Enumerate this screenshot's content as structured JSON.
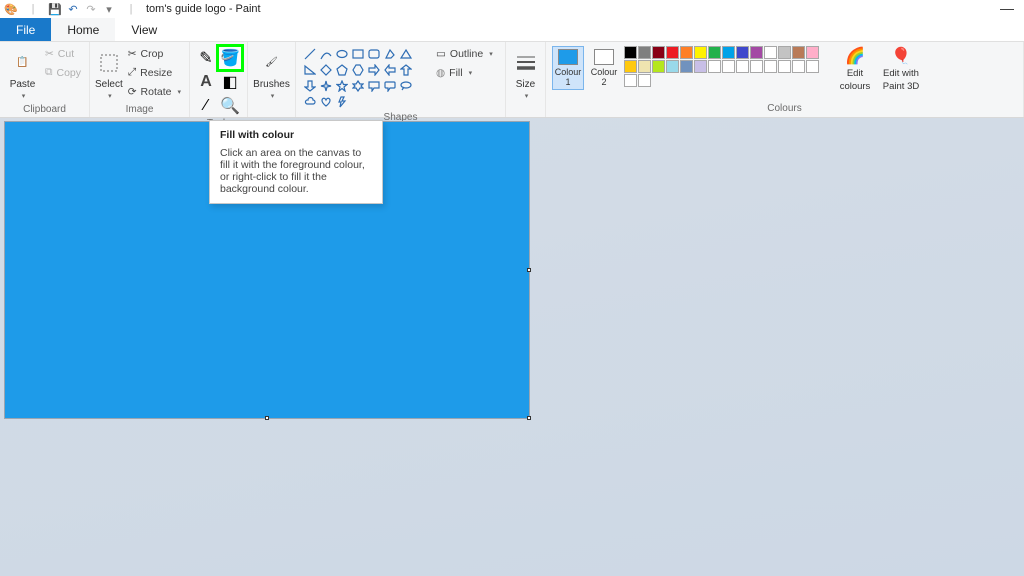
{
  "title": "tom's guide logo - Paint",
  "menu": {
    "file": "File",
    "home": "Home",
    "view": "View"
  },
  "qat": {
    "save": "save",
    "undo": "undo",
    "redo": "redo"
  },
  "groups": {
    "clipboard": "Clipboard",
    "image": "Image",
    "tools": "Tools",
    "shapes": "Shapes",
    "colours": "Colours"
  },
  "clipboard": {
    "paste": "Paste",
    "cut": "Cut",
    "copy": "Copy"
  },
  "image": {
    "select": "Select",
    "crop": "Crop",
    "resize": "Resize",
    "rotate": "Rotate"
  },
  "brushes": "Brushes",
  "shapes_opts": {
    "outline": "Outline",
    "fill": "Fill"
  },
  "size": "Size",
  "colour1": {
    "label1": "Colour",
    "label2": "1",
    "hex": "#1e9be9"
  },
  "colour2": {
    "label1": "Colour",
    "label2": "2",
    "hex": "#ffffff"
  },
  "edit_colours": {
    "l1": "Edit",
    "l2": "colours"
  },
  "paint3d": {
    "l1": "Edit with",
    "l2": "Paint 3D"
  },
  "palette_row1": [
    "#000000",
    "#7f7f7f",
    "#880015",
    "#ed1c24",
    "#ff7f27",
    "#fff200",
    "#22b14c",
    "#00a2e8",
    "#3f48cc",
    "#a349a4"
  ],
  "palette_row2": [
    "#ffffff",
    "#c3c3c3",
    "#b97a57",
    "#ffaec9",
    "#ffc90e",
    "#efe4b0",
    "#b5e61d",
    "#99d9ea",
    "#7092be",
    "#c8bfe7"
  ],
  "palette_row3": [
    "#ffffff",
    "#ffffff",
    "#ffffff",
    "#ffffff",
    "#ffffff",
    "#ffffff",
    "#ffffff",
    "#ffffff",
    "#ffffff",
    "#ffffff"
  ],
  "tooltip": {
    "title": "Fill with colour",
    "body": "Click an area on the canvas to fill it with the foreground colour, or right-click to fill it the background colour."
  },
  "canvas_fill": "#1e9be9"
}
